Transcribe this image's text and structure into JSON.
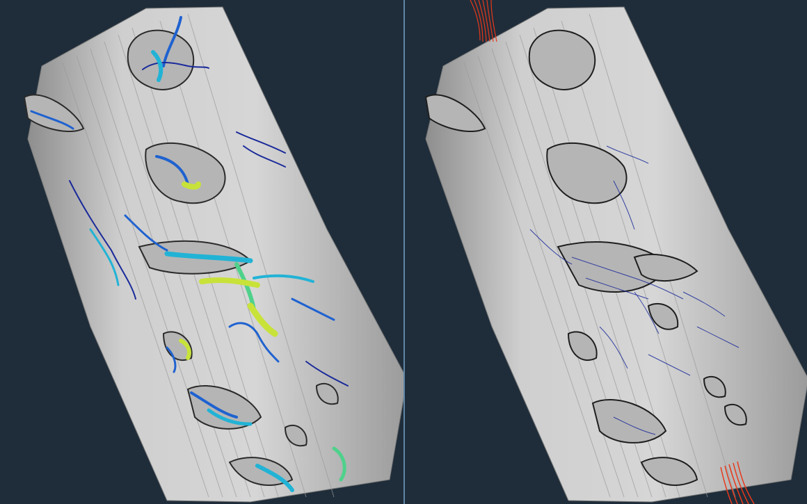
{
  "scene": {
    "background_color": "#1f2d3a",
    "divider_color": "#5f86a6",
    "surface_color": "#c9c9c9",
    "surface_shadow_color": "#8f8f8f",
    "pore_edge_color": "#222222",
    "colormap": [
      "#1a2a9a",
      "#1f62d0",
      "#21b3d6",
      "#4fd18b",
      "#c8e23a",
      "#f2c21a",
      "#e8381a"
    ]
  },
  "viewports": [
    {
      "id": "left",
      "render": "streamtubes"
    },
    {
      "id": "right",
      "render": "streamlines"
    }
  ]
}
